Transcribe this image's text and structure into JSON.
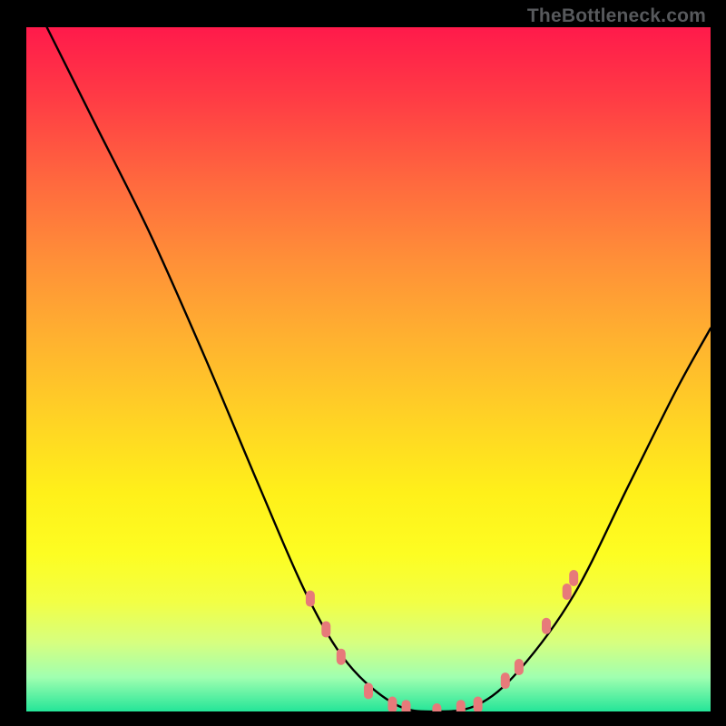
{
  "watermark": "TheBottleneck.com",
  "chart_data": {
    "type": "line",
    "title": "",
    "xlabel": "",
    "ylabel": "",
    "xlim": [
      0,
      1
    ],
    "ylim": [
      0,
      1
    ],
    "series": [
      {
        "name": "curve",
        "x": [
          0.03,
          0.1,
          0.18,
          0.26,
          0.34,
          0.41,
          0.47,
          0.54,
          0.6,
          0.66,
          0.72,
          0.8,
          0.88,
          0.95,
          1.0
        ],
        "y": [
          1.0,
          0.86,
          0.7,
          0.52,
          0.33,
          0.17,
          0.07,
          0.01,
          0.0,
          0.01,
          0.06,
          0.17,
          0.33,
          0.47,
          0.56
        ]
      }
    ],
    "markers": {
      "name": "dots",
      "color_hex": "#e77a7a",
      "x": [
        0.415,
        0.438,
        0.46,
        0.5,
        0.535,
        0.555,
        0.6,
        0.635,
        0.66,
        0.7,
        0.72,
        0.76,
        0.79,
        0.8
      ],
      "y": [
        0.165,
        0.12,
        0.08,
        0.03,
        0.01,
        0.005,
        0.0,
        0.005,
        0.01,
        0.045,
        0.065,
        0.125,
        0.175,
        0.195
      ]
    },
    "gradient_stops": [
      {
        "pos": 0.0,
        "hex": "#ff1a4b"
      },
      {
        "pos": 0.23,
        "hex": "#ff6a3e"
      },
      {
        "pos": 0.57,
        "hex": "#ffd225"
      },
      {
        "pos": 0.84,
        "hex": "#f2ff45"
      },
      {
        "pos": 1.0,
        "hex": "#24e598"
      }
    ]
  }
}
